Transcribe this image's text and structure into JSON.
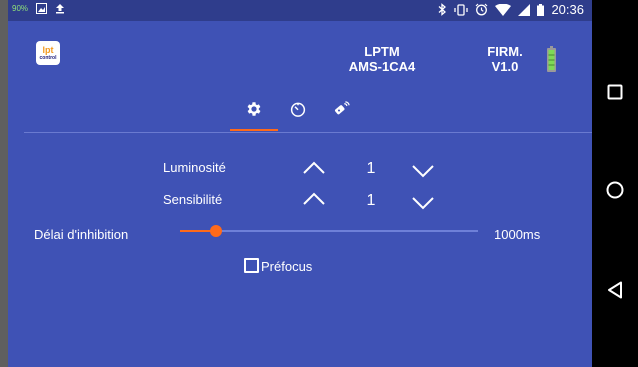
{
  "status_bar": {
    "battery_percent": "90%",
    "time": "20:36",
    "icons": [
      "image-icon",
      "upload-icon",
      "bluetooth-icon",
      "vibrate-icon",
      "alarm-icon",
      "wifi-icon",
      "signal-icon",
      "battery-icon"
    ]
  },
  "header": {
    "logo_text_top": "lpt",
    "logo_text_bottom": "control",
    "device_line1": "LPTM",
    "device_line2": "AMS-1CA4",
    "firm_line1": "FIRM.",
    "firm_line2": "V1.0",
    "battery_color": "#7ed957"
  },
  "tabs": [
    {
      "name": "settings",
      "icon": "gear-icon",
      "selected": true
    },
    {
      "name": "timer",
      "icon": "timer-icon",
      "selected": false
    },
    {
      "name": "remote",
      "icon": "remote-signal-icon",
      "selected": false
    }
  ],
  "settings": {
    "luminosite_label": "Luminosité",
    "luminosite_value": "1",
    "sensibilite_label": "Sensibilité",
    "sensibilite_value": "1",
    "delai_label": "Délai d'inhibition",
    "delai_value": "1000ms",
    "delai_fraction": 0.12,
    "prefocus_label": "Préfocus",
    "prefocus_checked": false
  },
  "colors": {
    "background": "#3f52b5",
    "statusbar": "#2f3d8c",
    "accent": "#ff6a1a"
  }
}
